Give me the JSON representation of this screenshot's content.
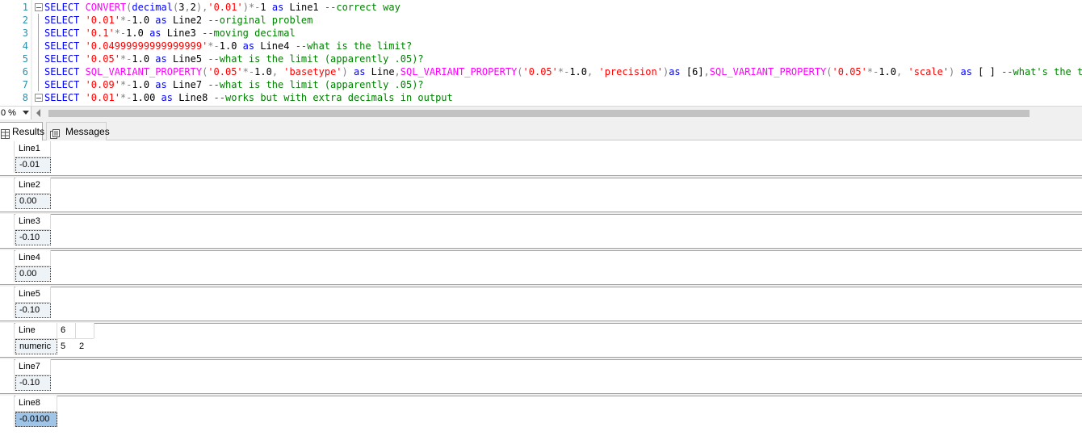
{
  "editor": {
    "lines": [
      {
        "num": "1",
        "tokens": [
          [
            "kw",
            "SELECT "
          ],
          [
            "fn",
            "CONVERT"
          ],
          [
            "op",
            "("
          ],
          [
            "kw",
            "decimal"
          ],
          [
            "op",
            "("
          ],
          [
            "txt",
            "3"
          ],
          [
            "op",
            ","
          ],
          [
            "txt",
            "2"
          ],
          [
            "op",
            "),"
          ],
          [
            "str",
            "'0.01'"
          ],
          [
            "op",
            ")*-"
          ],
          [
            "txt",
            "1 "
          ],
          [
            "kw",
            "as"
          ],
          [
            "txt",
            " Line1 "
          ],
          [
            "cm",
            "--correct way"
          ]
        ]
      },
      {
        "num": "2",
        "tokens": [
          [
            "kw",
            "SELECT "
          ],
          [
            "str",
            "'0.01'"
          ],
          [
            "op",
            "*-"
          ],
          [
            "txt",
            "1.0 "
          ],
          [
            "kw",
            "as"
          ],
          [
            "txt",
            " Line2 "
          ],
          [
            "cm",
            "--original problem"
          ]
        ]
      },
      {
        "num": "3",
        "tokens": [
          [
            "kw",
            "SELECT "
          ],
          [
            "str",
            "'0.1'"
          ],
          [
            "op",
            "*-"
          ],
          [
            "txt",
            "1.0 "
          ],
          [
            "kw",
            "as"
          ],
          [
            "txt",
            " Line3 "
          ],
          [
            "cm",
            "--moving decimal"
          ]
        ]
      },
      {
        "num": "4",
        "tokens": [
          [
            "kw",
            "SELECT "
          ],
          [
            "str",
            "'0.04999999999999999'"
          ],
          [
            "op",
            "*-"
          ],
          [
            "txt",
            "1.0 "
          ],
          [
            "kw",
            "as"
          ],
          [
            "txt",
            " Line4 "
          ],
          [
            "cm",
            "--what is the limit?"
          ]
        ]
      },
      {
        "num": "5",
        "tokens": [
          [
            "kw",
            "SELECT "
          ],
          [
            "str",
            "'0.05'"
          ],
          [
            "op",
            "*-"
          ],
          [
            "txt",
            "1.0 "
          ],
          [
            "kw",
            "as"
          ],
          [
            "txt",
            " Line5 "
          ],
          [
            "cm",
            "--what is the limit (apparently .05)?"
          ]
        ]
      },
      {
        "num": "6",
        "tokens": [
          [
            "kw",
            "SELECT "
          ],
          [
            "fn",
            "SQL_VARIANT_PROPERTY"
          ],
          [
            "op",
            "("
          ],
          [
            "str",
            "'0.05'"
          ],
          [
            "op",
            "*-"
          ],
          [
            "txt",
            "1.0"
          ],
          [
            "op",
            ", "
          ],
          [
            "str",
            "'basetype'"
          ],
          [
            "op",
            ") "
          ],
          [
            "kw",
            "as"
          ],
          [
            "txt",
            " Line"
          ],
          [
            "op",
            ","
          ],
          [
            "fn",
            "SQL_VARIANT_PROPERTY"
          ],
          [
            "op",
            "("
          ],
          [
            "str",
            "'0.05'"
          ],
          [
            "op",
            "*-"
          ],
          [
            "txt",
            "1.0"
          ],
          [
            "op",
            ", "
          ],
          [
            "str",
            "'precision'"
          ],
          [
            "op",
            ")"
          ],
          [
            "kw",
            "as"
          ],
          [
            "txt",
            " [6]"
          ],
          [
            "op",
            ","
          ],
          [
            "fn",
            "SQL_VARIANT_PROPERTY"
          ],
          [
            "op",
            "("
          ],
          [
            "str",
            "'0.05'"
          ],
          [
            "op",
            "*-"
          ],
          [
            "txt",
            "1.0"
          ],
          [
            "op",
            ", "
          ],
          [
            "str",
            "'scale'"
          ],
          [
            "op",
            ") "
          ],
          [
            "kw",
            "as"
          ],
          [
            "txt",
            " [ ] "
          ],
          [
            "cm",
            "--what's the type"
          ]
        ]
      },
      {
        "num": "7",
        "tokens": [
          [
            "kw",
            "SELECT "
          ],
          [
            "str",
            "'0.09'"
          ],
          [
            "op",
            "*-"
          ],
          [
            "txt",
            "1.0 "
          ],
          [
            "kw",
            "as"
          ],
          [
            "txt",
            " Line7 "
          ],
          [
            "cm",
            "--what is the limit (apparently .05)?"
          ]
        ]
      },
      {
        "num": "8",
        "tokens": [
          [
            "kw",
            "SELECT "
          ],
          [
            "str",
            "'0.01'"
          ],
          [
            "op",
            "*-"
          ],
          [
            "txt",
            "1.00 "
          ],
          [
            "kw",
            "as"
          ],
          [
            "txt",
            " Line8 "
          ],
          [
            "cm",
            "--works but with extra decimals in output"
          ]
        ]
      }
    ],
    "zoom": "0 %"
  },
  "tabs": {
    "results_label": "Results",
    "messages_label": "Messages",
    "results_icon": "grid-icon",
    "messages_icon": "messages-icon"
  },
  "results": [
    {
      "columns": [
        "Line1"
      ],
      "values": [
        "-0.01"
      ]
    },
    {
      "columns": [
        "Line2"
      ],
      "values": [
        "0.00"
      ]
    },
    {
      "columns": [
        "Line3"
      ],
      "values": [
        "-0.10"
      ]
    },
    {
      "columns": [
        "Line4"
      ],
      "values": [
        "0.00"
      ]
    },
    {
      "columns": [
        "Line5"
      ],
      "values": [
        "-0.10"
      ]
    },
    {
      "columns": [
        "Line",
        "6",
        ""
      ],
      "values": [
        "numeric",
        "5",
        "2"
      ]
    },
    {
      "columns": [
        "Line7"
      ],
      "values": [
        "-0.10"
      ]
    },
    {
      "columns": [
        "Line8"
      ],
      "values": [
        "-0.0100"
      ]
    }
  ],
  "colors": {
    "keyword": "#0000ff",
    "function": "#ff00ff",
    "string": "#ff0000",
    "comment": "#008000",
    "operator": "#808080",
    "line_number": "#2b91af",
    "selected_cell": "#9ec5e8"
  }
}
